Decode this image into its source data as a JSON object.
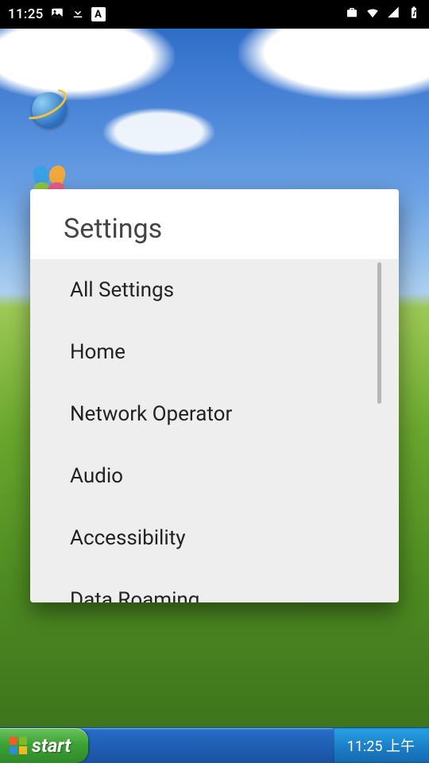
{
  "status_bar": {
    "time": "11:25"
  },
  "taskbar": {
    "start_label": "start",
    "clock": "11:25 上午"
  },
  "dialog": {
    "title": "Settings",
    "items": [
      "All Settings",
      "Home",
      "Network Operator",
      "Audio",
      "Accessibility",
      "Data Roaming"
    ]
  }
}
